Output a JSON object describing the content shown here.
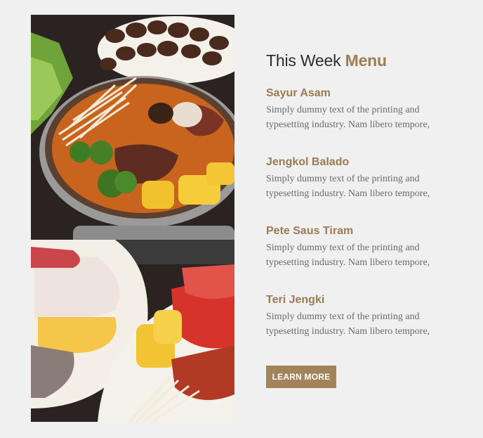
{
  "photo": {
    "subject": "hot pot with seafood, corn, mushrooms and sliced meat"
  },
  "heading": {
    "part1": "This Week",
    "part2": "Menu"
  },
  "menu": [
    {
      "name": "Sayur Asam",
      "desc": "Simply dummy text of the printing and typesetting industry. Nam libero tempore,"
    },
    {
      "name": "Jengkol Balado",
      "desc": "Simply dummy text of the printing and typesetting industry. Nam libero tempore,"
    },
    {
      "name": "Pete Saus Tiram",
      "desc": "Simply dummy text of the printing and typesetting industry. Nam libero tempore,"
    },
    {
      "name": "Teri Jengki",
      "desc": "Simply dummy text of the printing and typesetting industry. Nam libero tempore,"
    }
  ],
  "button": {
    "label": "LEARN MORE"
  },
  "colors": {
    "accent": "#9e7d55",
    "button": "#a2835a",
    "background": "#f1f0f1"
  }
}
